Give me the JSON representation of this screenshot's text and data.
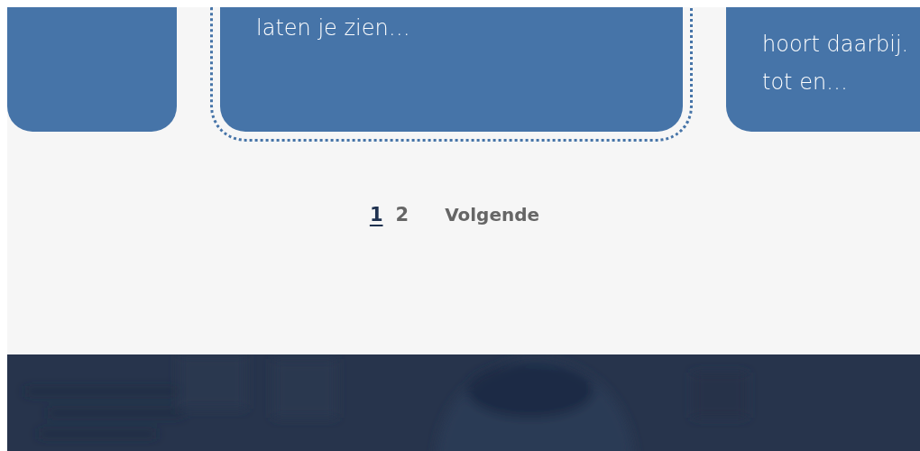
{
  "cards": [
    {
      "focused": false
    },
    {
      "lines": [
        "laten je zien…"
      ],
      "focused": true
    },
    {
      "lines": [
        "hoort daarbij.",
        "tot en…"
      ],
      "focused": false
    }
  ],
  "pagination": {
    "pages": [
      {
        "label": "1",
        "selected": true
      },
      {
        "label": "2",
        "selected": false
      }
    ],
    "next": "Volgende"
  }
}
